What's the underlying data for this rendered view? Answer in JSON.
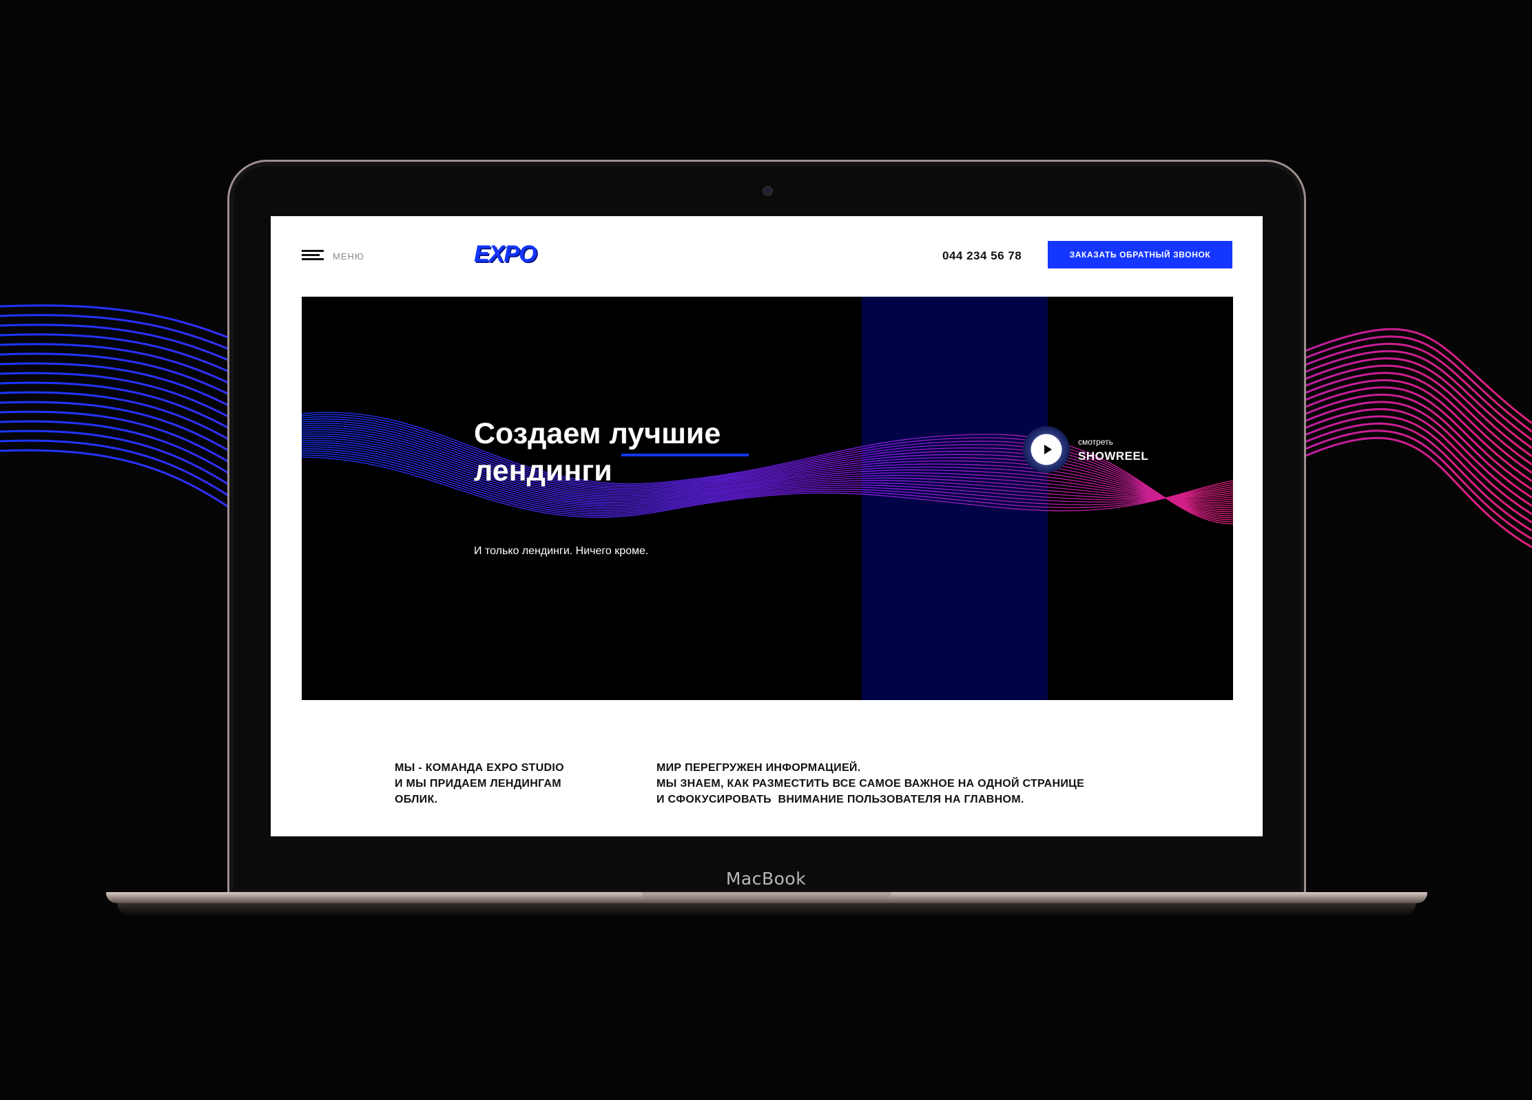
{
  "device": {
    "chin_label": "MacBook"
  },
  "header": {
    "menu_label": "МЕНЮ",
    "logo": "EXPO",
    "phone": "044 234 56 78",
    "cta_label": "ЗАКАЗАТЬ ОБРАТНЫЙ ЗВОНОК"
  },
  "hero": {
    "title_line1": "Создаем лучшие",
    "title_line2": "лендинги",
    "subtitle": "И только лендинги. Ничего кроме.",
    "watch_label": "смотреть",
    "showreel_label": "SHOWREEL"
  },
  "about": {
    "left_lines": [
      "МЫ - КОМАНДА EXPO STUDIO",
      "И МЫ ПРИДАЕМ ЛЕНДИНГАМ",
      "ОБЛИК."
    ],
    "right_lines": [
      "МИР ПЕРЕГРУЖЕН ИНФОРМАЦИЕЙ.",
      "МЫ ЗНАЕМ, КАК РАЗМЕСТИТЬ ВСЕ САМОЕ ВАЖНОЕ НА ОДНОЙ СТРАНИЦЕ",
      "И СФОКУСИРОВАТЬ  ВНИМАНИЕ ПОЛЬЗОВАТЕЛЯ НА ГЛАВНОМ."
    ]
  },
  "colors": {
    "accent": "#1436ff",
    "hero_band": "#000345",
    "wave_start": "#1a35ff",
    "wave_end": "#e0207a"
  },
  "icons": {
    "menu": "hamburger-icon",
    "play": "play-icon"
  }
}
